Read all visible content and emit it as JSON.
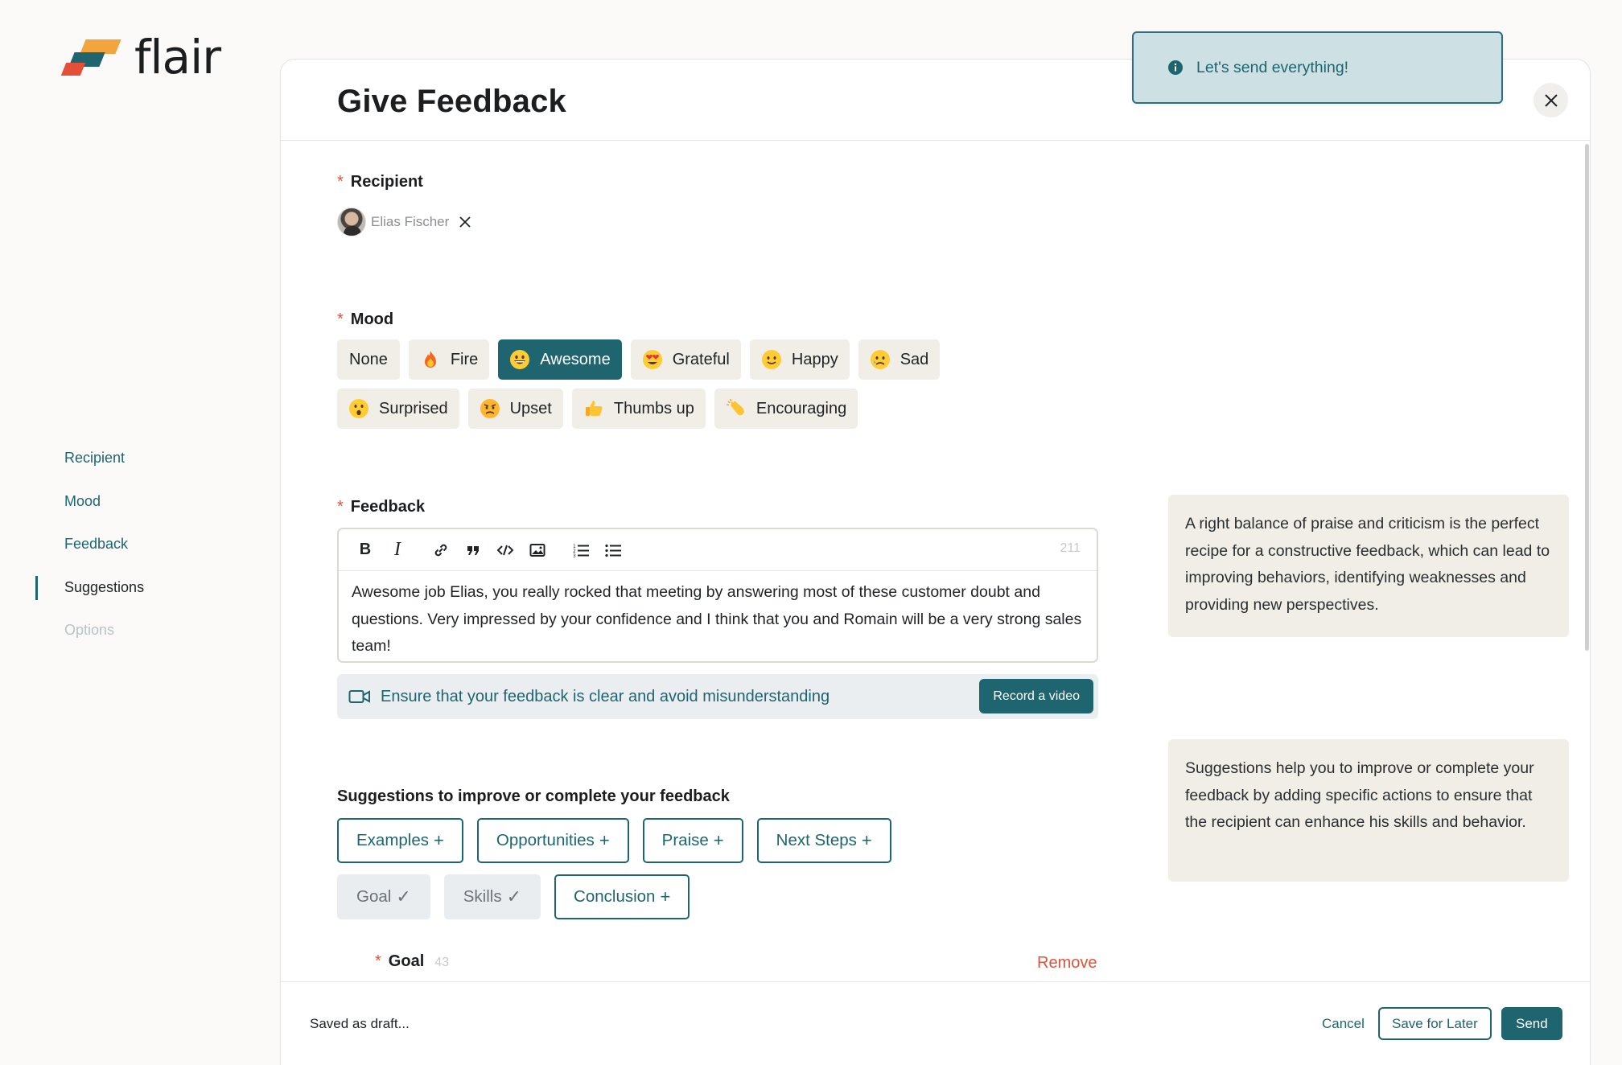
{
  "app": {
    "logo_text": "flair"
  },
  "nav": {
    "items": [
      {
        "label": "Recipient",
        "state": "link"
      },
      {
        "label": "Mood",
        "state": "link"
      },
      {
        "label": "Feedback",
        "state": "link"
      },
      {
        "label": "Suggestions",
        "state": "active"
      },
      {
        "label": "Options",
        "state": "disabled"
      }
    ]
  },
  "page": {
    "title": "Give Feedback"
  },
  "toast": {
    "message": "Let's send everything!",
    "icon": "info-icon"
  },
  "recipient": {
    "label": "Recipient",
    "required_mark": "*",
    "name": "Elias Fischer"
  },
  "mood": {
    "label": "Mood",
    "required_mark": "*",
    "selected": "Awesome",
    "options": [
      {
        "label": "None",
        "icon": ""
      },
      {
        "label": "Fire",
        "icon": "fire-icon"
      },
      {
        "label": "Awesome",
        "icon": "grinning-face-icon"
      },
      {
        "label": "Grateful",
        "icon": "heart-eyes-icon"
      },
      {
        "label": "Happy",
        "icon": "smiling-face-icon"
      },
      {
        "label": "Sad",
        "icon": "crying-face-icon"
      },
      {
        "label": "Surprised",
        "icon": "surprised-face-icon"
      },
      {
        "label": "Upset",
        "icon": "angry-face-icon"
      },
      {
        "label": "Thumbs up",
        "icon": "thumbs-up-icon"
      },
      {
        "label": "Encouraging",
        "icon": "clapping-hands-icon"
      }
    ]
  },
  "feedback": {
    "label": "Feedback",
    "required_mark": "*",
    "char_count": "211",
    "text": "Awesome job Elias, you really rocked that meeting by answering most of these customer doubt and questions. Very impressed by your confidence and I think that you and Romain will be a very strong sales team!",
    "video_hint": "Ensure that your feedback is clear and avoid misunderstanding",
    "record_label": "Record a video"
  },
  "suggestions": {
    "title": "Suggestions to improve or complete your feedback",
    "items": [
      {
        "label": "Examples",
        "mark": "+"
      },
      {
        "label": "Opportunities",
        "mark": "+"
      },
      {
        "label": "Praise",
        "mark": "+"
      },
      {
        "label": "Next Steps",
        "mark": "+"
      },
      {
        "label": "Goal",
        "mark": "✓"
      },
      {
        "label": "Skills",
        "mark": "✓"
      },
      {
        "label": "Conclusion",
        "mark": "+"
      }
    ]
  },
  "goal": {
    "label": "Goal",
    "required_mark": "*",
    "count": "43",
    "remove_label": "Remove"
  },
  "tips": {
    "feedback": "A right balance of praise and criticism is the perfect recipe for a constructive feedback, which can lead to improving behaviors, identifying weaknesses and providing new perspectives.",
    "suggestions": "Suggestions help you to improve or complete your feedback by adding specific actions to ensure that the recipient can enhance his skills and behavior."
  },
  "footer": {
    "status": "Saved as draft...",
    "cancel_label": "Cancel",
    "save_later_label": "Save for Later",
    "send_label": "Send"
  },
  "colors": {
    "accent": "#1e6570",
    "required": "#e0533a",
    "chip_bg": "#f1eee8",
    "toast_bg": "#cde0e4"
  }
}
